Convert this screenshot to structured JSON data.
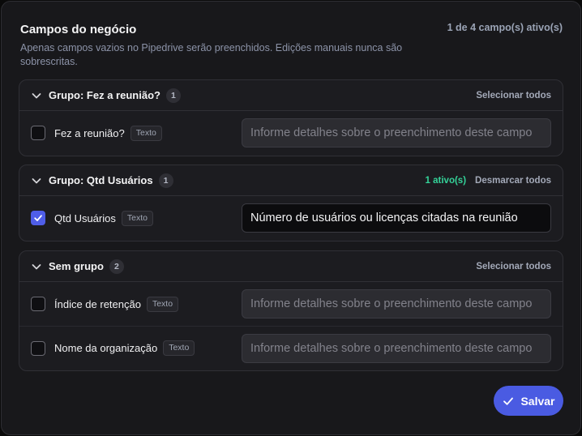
{
  "header": {
    "title": "Campos do negócio",
    "counter": "1 de 4 campo(s) ativo(s)",
    "subtitle": "Apenas campos vazios no Pipedrive serão preenchidos. Edições manuais nunca são sobrescritas."
  },
  "groups": [
    {
      "title": "Grupo: Fez a reunião?",
      "count": "1",
      "active_label": "",
      "action_label": "Selecionar todos",
      "fields": [
        {
          "name": "Fez a reunião?",
          "type": "Texto",
          "checked": false,
          "value": "",
          "placeholder": "Informe detalhes sobre o preenchimento deste campo"
        }
      ]
    },
    {
      "title": "Grupo: Qtd Usuários",
      "count": "1",
      "active_label": "1 ativo(s)",
      "action_label": "Desmarcar todos",
      "fields": [
        {
          "name": "Qtd Usuários",
          "type": "Texto",
          "checked": true,
          "value": "Número de usuários ou licenças citadas na reunião",
          "placeholder": "Informe detalhes sobre o preenchimento deste campo"
        }
      ]
    },
    {
      "title": "Sem grupo",
      "count": "2",
      "active_label": "",
      "action_label": "Selecionar todos",
      "fields": [
        {
          "name": "Índice de retenção",
          "type": "Texto",
          "checked": false,
          "value": "",
          "placeholder": "Informe detalhes sobre o preenchimento deste campo"
        },
        {
          "name": "Nome da organização",
          "type": "Texto",
          "checked": false,
          "value": "",
          "placeholder": "Informe detalhes sobre o preenchimento deste campo"
        }
      ]
    }
  ],
  "footer": {
    "save_label": "Salvar",
    "save_icon": "check-icon"
  },
  "colors": {
    "accent": "#4a5be2",
    "active_green": "#34d399"
  }
}
